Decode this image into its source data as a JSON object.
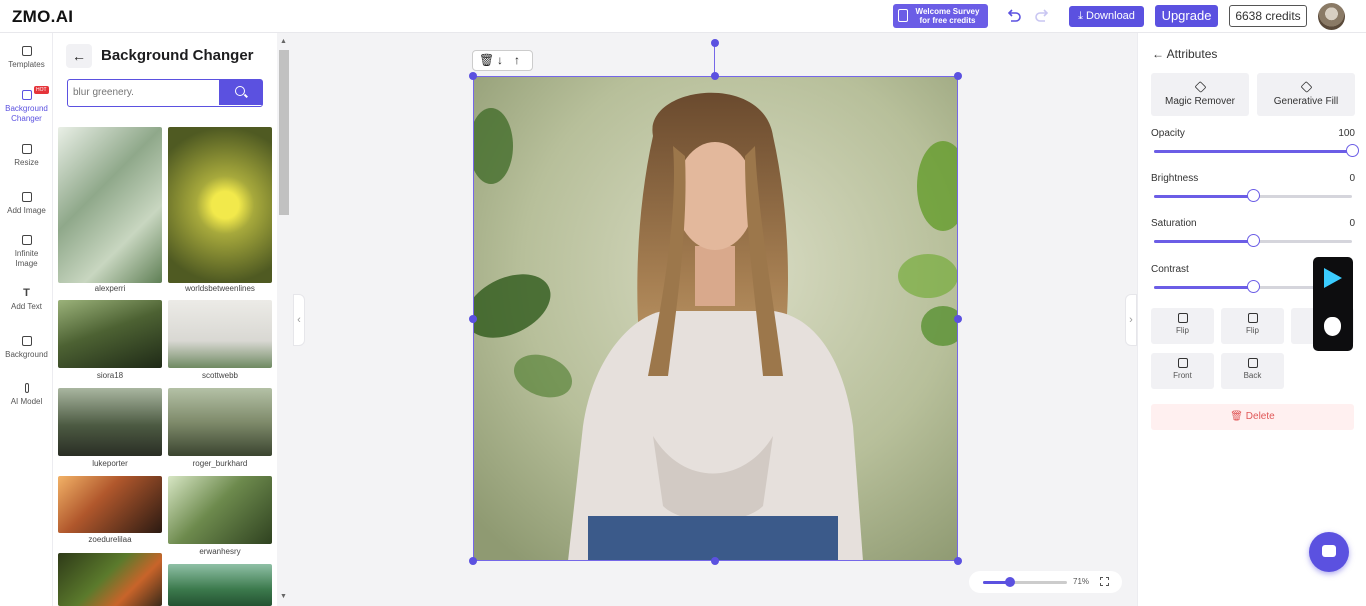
{
  "header": {
    "logo": "ZMO.AI",
    "survey_line1": "Welcome Survey",
    "survey_line2": "for free credits",
    "download_label": "Download",
    "upgrade_label": "Upgrade",
    "credits": "6638 credits"
  },
  "rail": {
    "items": [
      {
        "label": "Templates",
        "icon": "templates-icon"
      },
      {
        "label": "Background Changer",
        "icon": "layers-icon",
        "badge": "HOT"
      },
      {
        "label": "Resize",
        "icon": "crop-icon"
      },
      {
        "label": "Add Image",
        "icon": "image-icon"
      },
      {
        "label": "Infinite Image",
        "icon": "infinite-image-icon"
      },
      {
        "label": "Add Text",
        "icon": "text-icon"
      },
      {
        "label": "Background",
        "icon": "background-icon"
      },
      {
        "label": "AI Model",
        "icon": "model-icon"
      }
    ]
  },
  "panel": {
    "title": "Background Changer",
    "search_placeholder": "blur greenery.",
    "thumbnails": [
      {
        "caption": "alexperri",
        "color": "#8fa88a"
      },
      {
        "caption": "worldsbetweenlines",
        "color": "#a7a93c"
      },
      {
        "caption": "siora18",
        "color": "#4d6233"
      },
      {
        "caption": "scottwebb",
        "color": "#d9d8d3"
      },
      {
        "caption": "lukeporter",
        "color": "#4c5a42"
      },
      {
        "caption": "roger_burkhard",
        "color": "#7f8b6b"
      },
      {
        "caption": "zoedurelilaa",
        "color": "#b0572c"
      },
      {
        "caption": "erwanhesry",
        "color": "#6d8a4d"
      },
      {
        "caption": "",
        "color": "#5b7a2c"
      },
      {
        "caption": "",
        "color": "#3c7a4d"
      }
    ]
  },
  "canvas": {
    "zoom_percent": 71,
    "zoom_label": "71%"
  },
  "attributes": {
    "title": "Attributes",
    "magic_remover": "Magic Remover",
    "generative_fill": "Generative Fill",
    "sliders": [
      {
        "label": "Opacity",
        "value": "100",
        "fraction": 1.0
      },
      {
        "label": "Brightness",
        "value": "0",
        "fraction": 0.5
      },
      {
        "label": "Saturation",
        "value": "0",
        "fraction": 0.5
      },
      {
        "label": "Contrast",
        "value": "",
        "fraction": 0.5
      }
    ],
    "flip_h": "Flip",
    "flip_v": "Flip",
    "duplicate": "Du",
    "front": "Front",
    "back": "Back",
    "delete": "Delete"
  },
  "colors": {
    "accent": "#5b51e0",
    "delete_text": "#e05757"
  }
}
